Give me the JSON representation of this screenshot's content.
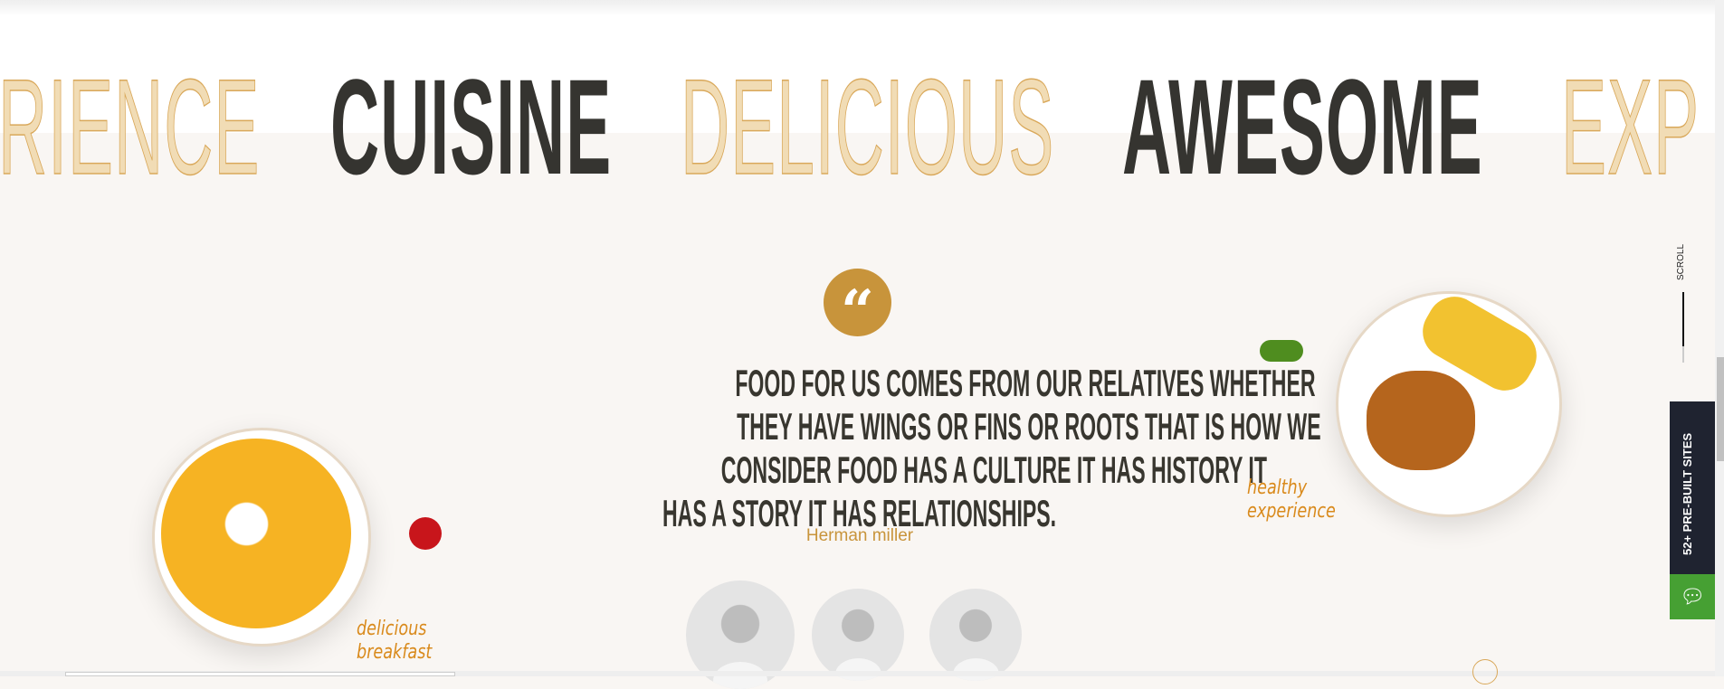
{
  "marquee": {
    "words": [
      {
        "text": "RIENCE",
        "style": "outline"
      },
      {
        "text": "CUISINE",
        "style": "solid"
      },
      {
        "text": "DELICIOUS",
        "style": "outline"
      },
      {
        "text": "AWESOME",
        "style": "solid"
      },
      {
        "text": "EXP",
        "style": "outline"
      }
    ]
  },
  "testimonial": {
    "icon": "quote-icon",
    "lines": [
      "FOOD FOR US COMES FROM OUR RELATIVES WHETHER",
      "THEY HAVE WINGS OR FINS OR ROOTS THAT IS HOW WE",
      "CONSIDER FOOD HAS A CULTURE IT HAS HISTORY IT",
      "HAS A STORY IT HAS RELATIONSHIPS."
    ],
    "author": "Herman miller"
  },
  "labels": {
    "left_line1": "delicious",
    "left_line2": "breakfast",
    "right_line1": "healthy",
    "right_line2": "experience"
  },
  "side": {
    "scroll": "SCROLL",
    "prebuilt": "52+ PRE-BUILT SITES",
    "chat_icon": "chat-bubble-icon"
  },
  "colors": {
    "accent": "#c8943b",
    "text": "#38362f",
    "background": "#f9f6f3",
    "dark_tab": "#1f2330",
    "green_tab": "#46a033"
  }
}
